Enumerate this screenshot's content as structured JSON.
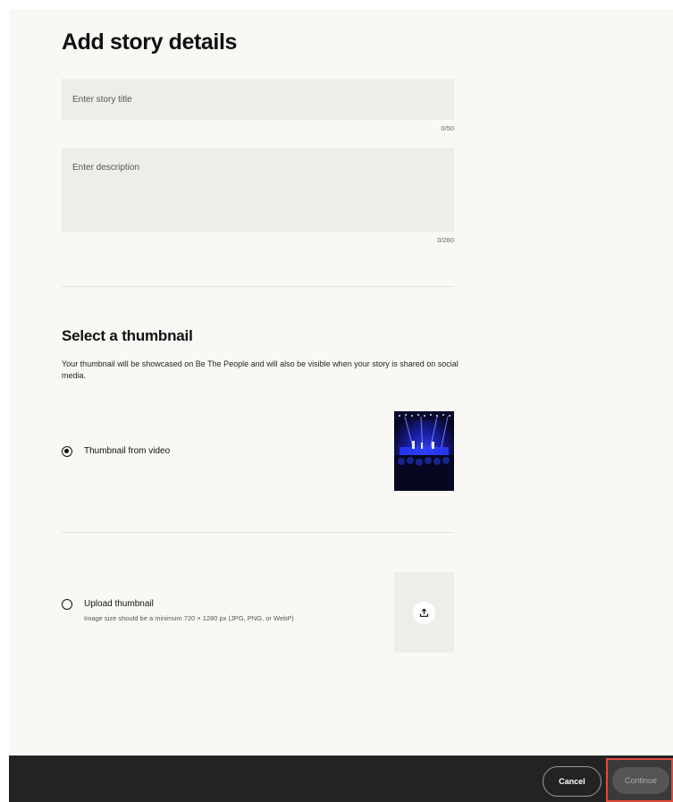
{
  "details": {
    "heading": "Add story details",
    "title_placeholder": "Enter story title",
    "title_value": "",
    "title_counter": "0/50",
    "description_placeholder": "Enter description",
    "description_value": "",
    "description_counter": "0/280"
  },
  "thumbnail": {
    "heading": "Select a thumbnail",
    "description": "Your thumbnail will be showcased on Be The People and will also be visible when your story is shared on social media.",
    "options": [
      {
        "label": "Thumbnail from video",
        "selected": true
      },
      {
        "label": "Upload thumbnail",
        "sublabel": "Image size should be a minimum 720 × 1280 px (JPG, PNG, or WebP)",
        "selected": false
      }
    ]
  },
  "footer": {
    "cancel_label": "Cancel",
    "continue_label": "Continue"
  },
  "colors": {
    "page_bg": "#faf8f5",
    "field_bg": "#efede9",
    "footer_bg": "#232323",
    "highlight": "#e04a3f"
  }
}
